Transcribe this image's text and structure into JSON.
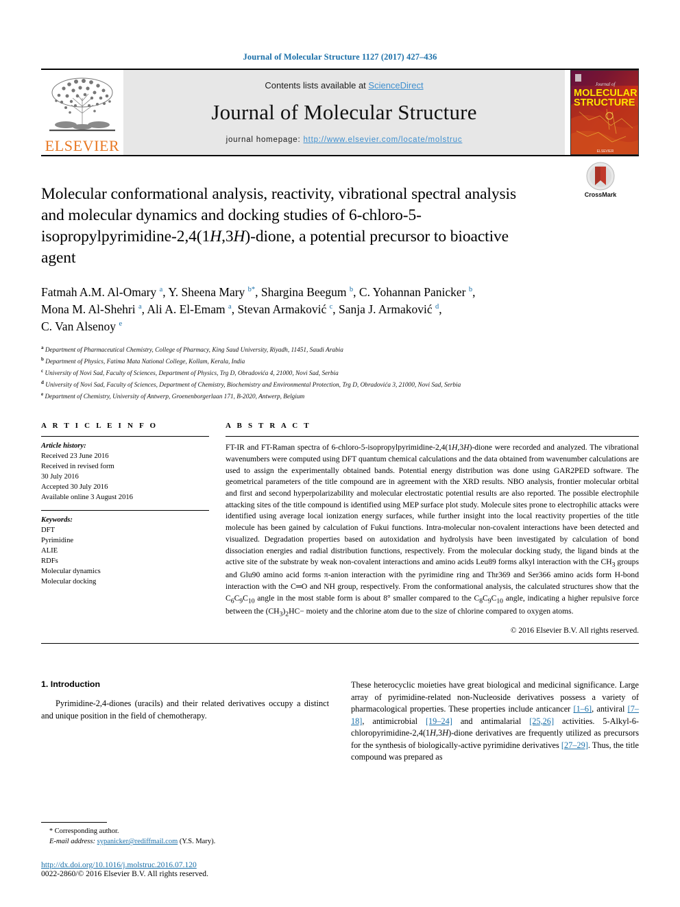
{
  "running_head": "Journal of Molecular Structure 1127 (2017) 427–436",
  "masthead": {
    "contents_prefix": "Contents lists available at ",
    "contents_link": "ScienceDirect",
    "journal_title": "Journal of Molecular Structure",
    "homepage_prefix": "journal homepage: ",
    "homepage_url": "http://www.elsevier.com/locate/molstruc",
    "publisher_logo_text": "ELSEVIER",
    "cover_line1": "Journal of",
    "cover_line2": "MOLECULAR",
    "cover_line3": "STRUCTURE",
    "cover_footer": "ELSEVIER",
    "colors": {
      "link": "#3f8fce",
      "elsevier_orange": "#E87722",
      "banner_bg": "#e7e7e7",
      "running_head": "#1a6fa8"
    }
  },
  "crossmark": {
    "label": "CrossMark"
  },
  "article": {
    "title_part1": "Molecular conformational analysis, reactivity, vibrational spectral analysis and molecular dynamics and docking studies of 6-chloro-5-isopropylpyrimidine-2,4(1",
    "title_italic1": "H",
    "title_part2": ",3",
    "title_italic2": "H",
    "title_part3": ")-dione, a potential precursor to bioactive agent",
    "authors_line1": "Fatmah A.M. Al-Omary ",
    "authors": [
      {
        "name": "Fatmah A.M. Al-Omary",
        "sup": "a",
        "star": false
      },
      {
        "name": "Y. Sheena Mary",
        "sup": "b",
        "star": true
      },
      {
        "name": "Shargina Beegum",
        "sup": "b",
        "star": false
      },
      {
        "name": "C. Yohannan Panicker",
        "sup": "b",
        "star": false
      },
      {
        "name": "Mona M. Al-Shehri",
        "sup": "a",
        "star": false
      },
      {
        "name": "Ali A. El-Emam",
        "sup": "a",
        "star": false
      },
      {
        "name": "Stevan Armaković",
        "sup": "c",
        "star": false
      },
      {
        "name": "Sanja J. Armaković",
        "sup": "d",
        "star": false
      },
      {
        "name": "C. Van Alsenoy",
        "sup": "e",
        "star": false
      }
    ],
    "affiliations": [
      {
        "sup": "a",
        "text": "Department of Pharmaceutical Chemistry, College of Pharmacy, King Saud University, Riyadh, 11451, Saudi Arabia"
      },
      {
        "sup": "b",
        "text": "Department of Physics, Fatima Mata National College, Kollam, Kerala, India"
      },
      {
        "sup": "c",
        "text": "University of Novi Sad, Faculty of Sciences, Department of Physics, Trg D, Obradovića 4, 21000, Novi Sad, Serbia"
      },
      {
        "sup": "d",
        "text": "University of Novi Sad, Faculty of Sciences, Department of Chemistry, Biochemistry and Environmental Protection, Trg D, Obradovića 3, 21000, Novi Sad, Serbia"
      },
      {
        "sup": "e",
        "text": "Department of Chemistry, University of Antwerp, Groenenborgerlaan 171, B-2020, Antwerp, Belgium"
      }
    ]
  },
  "article_info": {
    "heading": "A R T I C L E  I N F O",
    "history_label": "Article history:",
    "history": [
      "Received 23 June 2016",
      "Received in revised form",
      "30 July 2016",
      "Accepted 30 July 2016",
      "Available online 3 August 2016"
    ],
    "keywords_label": "Keywords:",
    "keywords": [
      "DFT",
      "Pyrimidine",
      "ALIE",
      "RDFs",
      "Molecular dynamics",
      "Molecular docking"
    ]
  },
  "abstract": {
    "heading": "A B S T R A C T",
    "text_p1": "FT-IR and FT-Raman spectra of 6-chloro-5-isopropylpyrimidine-2,4(1",
    "text_p2": ",3",
    "text_p3": ")-dione were recorded and analyzed. The vibrational wavenumbers were computed using DFT quantum chemical calculations and the data obtained from wavenumber calculations are used to assign the experimentally obtained bands. Potential energy distribution was done using GAR2PED software. The geometrical parameters of the title compound are in agreement with the XRD results. NBO analysis, frontier molecular orbital and first and second hyperpolarizability and molecular electrostatic potential results are also reported. The possible electrophile attacking sites of the title compound is identified using MEP surface plot study. Molecule sites prone to electrophilic attacks were identified using average local ionization energy surfaces, while further insight into the local reactivity properties of the title molecule has been gained by calculation of Fukui functions. Intra-molecular non-covalent interactions have been detected and visualized. Degradation properties based on autoxidation and hydrolysis have been investigated by calculation of bond dissociation energies and radial distribution functions, respectively. From the molecular docking study, the ligand binds at the active site of the substrate by weak non-covalent interactions and amino acids Leu89 forms alkyl interaction with the CH",
    "text_p4": " groups and Glu90 amino acid forms π-anion interaction with the pyrimidine ring and Thr369 and Ser366 amino acids form H-bond interaction with the C═O and NH group, respectively. From the conformational analysis, the calculated structures show that the C",
    "text_p5": "C",
    "text_p6": "C",
    "text_p7": " angle in the most stable form is about 8° smaller compared to the C",
    "text_p8": "C",
    "text_p9": "C",
    "text_p10": " angle, indicating a higher repulsive force between the (CH",
    "text_p11": ")",
    "text_p12": "HC− moiety and the chlorine atom due to the size of chlorine compared to oxygen atoms.",
    "italic_H": "H",
    "sub_3": "3",
    "sub_6": "6",
    "sub_9": "9",
    "sub_10": "10",
    "sub_8": "8",
    "sub_2": "2",
    "copyright": "© 2016 Elsevier B.V. All rights reserved."
  },
  "body": {
    "section_number_title": "1.  Introduction",
    "left_paragraph": "Pyrimidine-2,4-diones (uracils) and their related derivatives occupy a distinct and unique position in the field of chemotherapy.",
    "right_paragraph_1": "These heterocyclic moieties have great biological and medicinal significance. Large array of pyrimidine-related non-Nucleoside derivatives possess a variety of pharmacological properties. These properties include anticancer ",
    "ref_1_6": "[1–6]",
    "right_paragraph_2": ", antiviral ",
    "ref_7_18": "[7–18]",
    "right_paragraph_3": ", antimicrobial ",
    "ref_19_24": "[19–24]",
    "right_paragraph_4": " and antimalarial ",
    "ref_25_26": "[25,26]",
    "right_paragraph_5": " activities. 5-Alkyl-6-chloropyrimidine-2,4(1",
    "right_paragraph_6": ",3",
    "right_paragraph_7": ")-dione derivatives are frequently utilized as precursors for the synthesis of biologically-active pyrimidine derivatives ",
    "ref_27_29": "[27–29]",
    "right_paragraph_8": ". Thus, the title compound was prepared as"
  },
  "footer": {
    "corresponding_star": "*",
    "corresponding_label": "Corresponding author.",
    "email_label": "E-mail address:",
    "email": "sypanicker@rediffmail.com",
    "email_attrib": "(Y.S. Mary).",
    "doi": "http://dx.doi.org/10.1016/j.molstruc.2016.07.120",
    "issn": "0022-2860/© 2016 Elsevier B.V. All rights reserved."
  }
}
